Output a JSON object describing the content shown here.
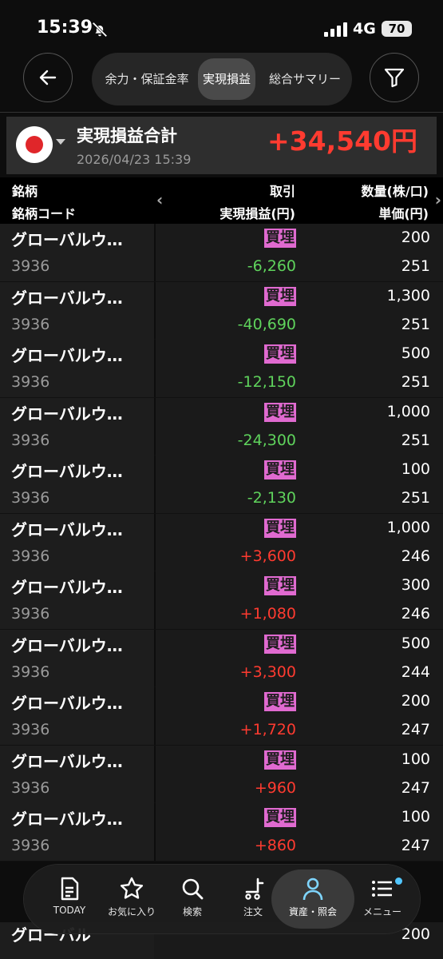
{
  "status_bar": {
    "time": "15:39",
    "network": "4G",
    "battery": "70"
  },
  "nav": {
    "tabs": [
      {
        "label": "余力・保証金率"
      },
      {
        "label": "実現損益"
      },
      {
        "label": "総合サマリー"
      }
    ]
  },
  "summary": {
    "title": "実現損益合計",
    "date": "2026/04/23 15:39",
    "total": "+34,540円"
  },
  "table_header": {
    "col1_line1": "銘柄",
    "col1_line2": "銘柄コード",
    "col2_line1": "取引",
    "col2_line2": "実現損益(円)",
    "col3_line1": "数量(株/口)",
    "col3_line2": "単価(円)"
  },
  "rows": [
    {
      "name": "グローバルウ…",
      "code": "3936",
      "trade": "買埋",
      "pl": "-6,260",
      "sign": "neg",
      "qty": "200",
      "price": "251"
    },
    {
      "name": "グローバルウ…",
      "code": "3936",
      "trade": "買埋",
      "pl": "-40,690",
      "sign": "neg",
      "qty": "1,300",
      "price": "251"
    },
    {
      "name": "グローバルウ…",
      "code": "3936",
      "trade": "買埋",
      "pl": "-12,150",
      "sign": "neg",
      "qty": "500",
      "price": "251"
    },
    {
      "name": "グローバルウ…",
      "code": "3936",
      "trade": "買埋",
      "pl": "-24,300",
      "sign": "neg",
      "qty": "1,000",
      "price": "251"
    },
    {
      "name": "グローバルウ…",
      "code": "3936",
      "trade": "買埋",
      "pl": "-2,130",
      "sign": "neg",
      "qty": "100",
      "price": "251"
    },
    {
      "name": "グローバルウ…",
      "code": "3936",
      "trade": "買埋",
      "pl": "+3,600",
      "sign": "pos",
      "qty": "1,000",
      "price": "246"
    },
    {
      "name": "グローバルウ…",
      "code": "3936",
      "trade": "買埋",
      "pl": "+1,080",
      "sign": "pos",
      "qty": "300",
      "price": "246"
    },
    {
      "name": "グローバルウ…",
      "code": "3936",
      "trade": "買埋",
      "pl": "+3,300",
      "sign": "pos",
      "qty": "500",
      "price": "244"
    },
    {
      "name": "グローバルウ…",
      "code": "3936",
      "trade": "買埋",
      "pl": "+1,720",
      "sign": "pos",
      "qty": "200",
      "price": "247"
    },
    {
      "name": "グローバルウ…",
      "code": "3936",
      "trade": "買埋",
      "pl": "+960",
      "sign": "pos",
      "qty": "100",
      "price": "247"
    },
    {
      "name": "グローバルウ…",
      "code": "3936",
      "trade": "買埋",
      "pl": "+860",
      "sign": "pos",
      "qty": "100",
      "price": "247"
    }
  ],
  "partial_row": {
    "name": "グローバル",
    "qty": "200"
  },
  "bottom_nav": [
    {
      "label": "TODAY",
      "icon": "document-icon"
    },
    {
      "label": "お気に入り",
      "icon": "star-icon"
    },
    {
      "label": "検索",
      "icon": "search-icon"
    },
    {
      "label": "注文",
      "icon": "cart-icon"
    },
    {
      "label": "資産・照会",
      "icon": "person-icon"
    },
    {
      "label": "メニュー",
      "icon": "menu-icon"
    }
  ],
  "colors": {
    "negative": "#5fd35c",
    "positive": "#ff3b30",
    "badge": "#e06ad0",
    "active_tab": "#4a4a4a"
  }
}
